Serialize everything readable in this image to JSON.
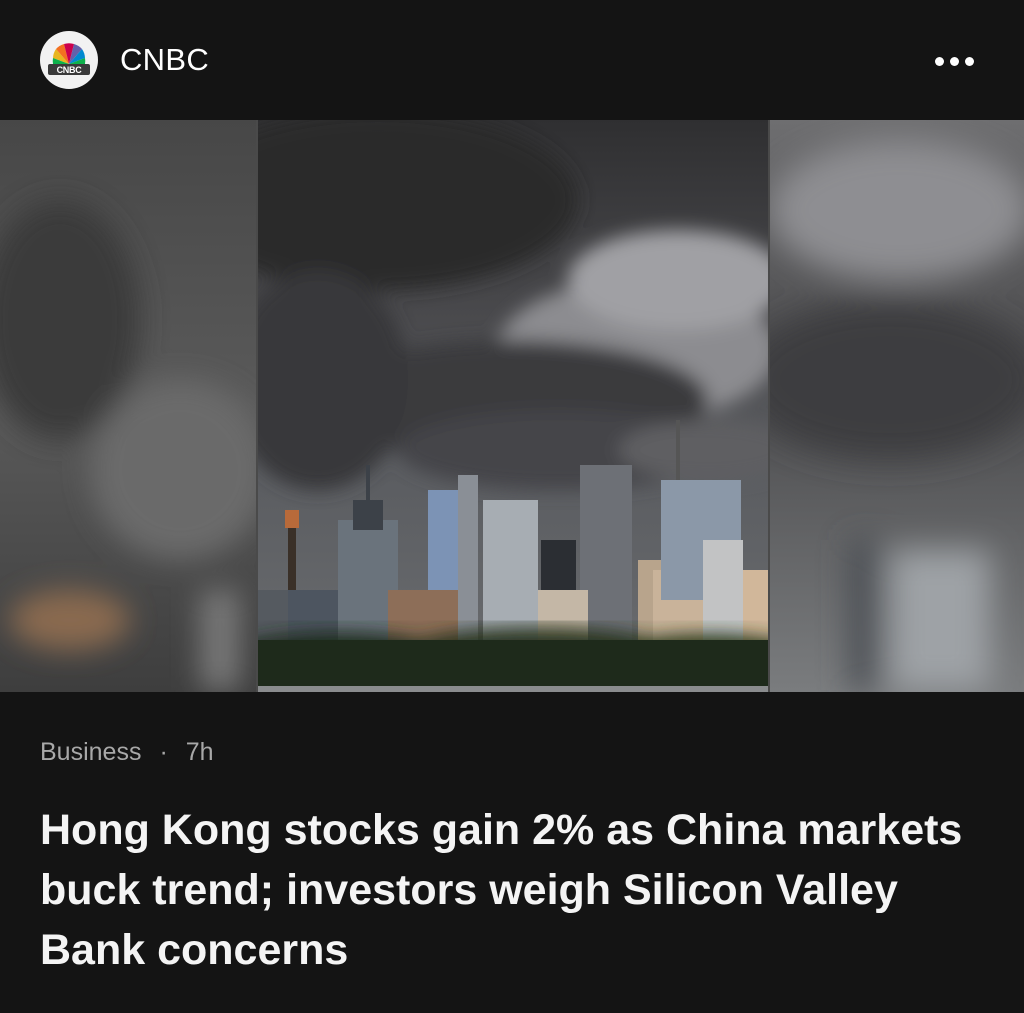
{
  "header": {
    "source_name": "CNBC",
    "logo_icon": "nbc-peacock-logo",
    "logo_text": "CNBC",
    "more_icon": "more-horizontal-icon"
  },
  "article": {
    "category": "Business",
    "separator": "·",
    "age": "7h",
    "headline": "Hong Kong stocks gain 2% as China markets buck trend; investors weigh Silicon Valley Bank concerns"
  },
  "colors": {
    "background": "#141414",
    "meta_text": "#a8a8a8",
    "headline_text": "#f4f4f4"
  }
}
